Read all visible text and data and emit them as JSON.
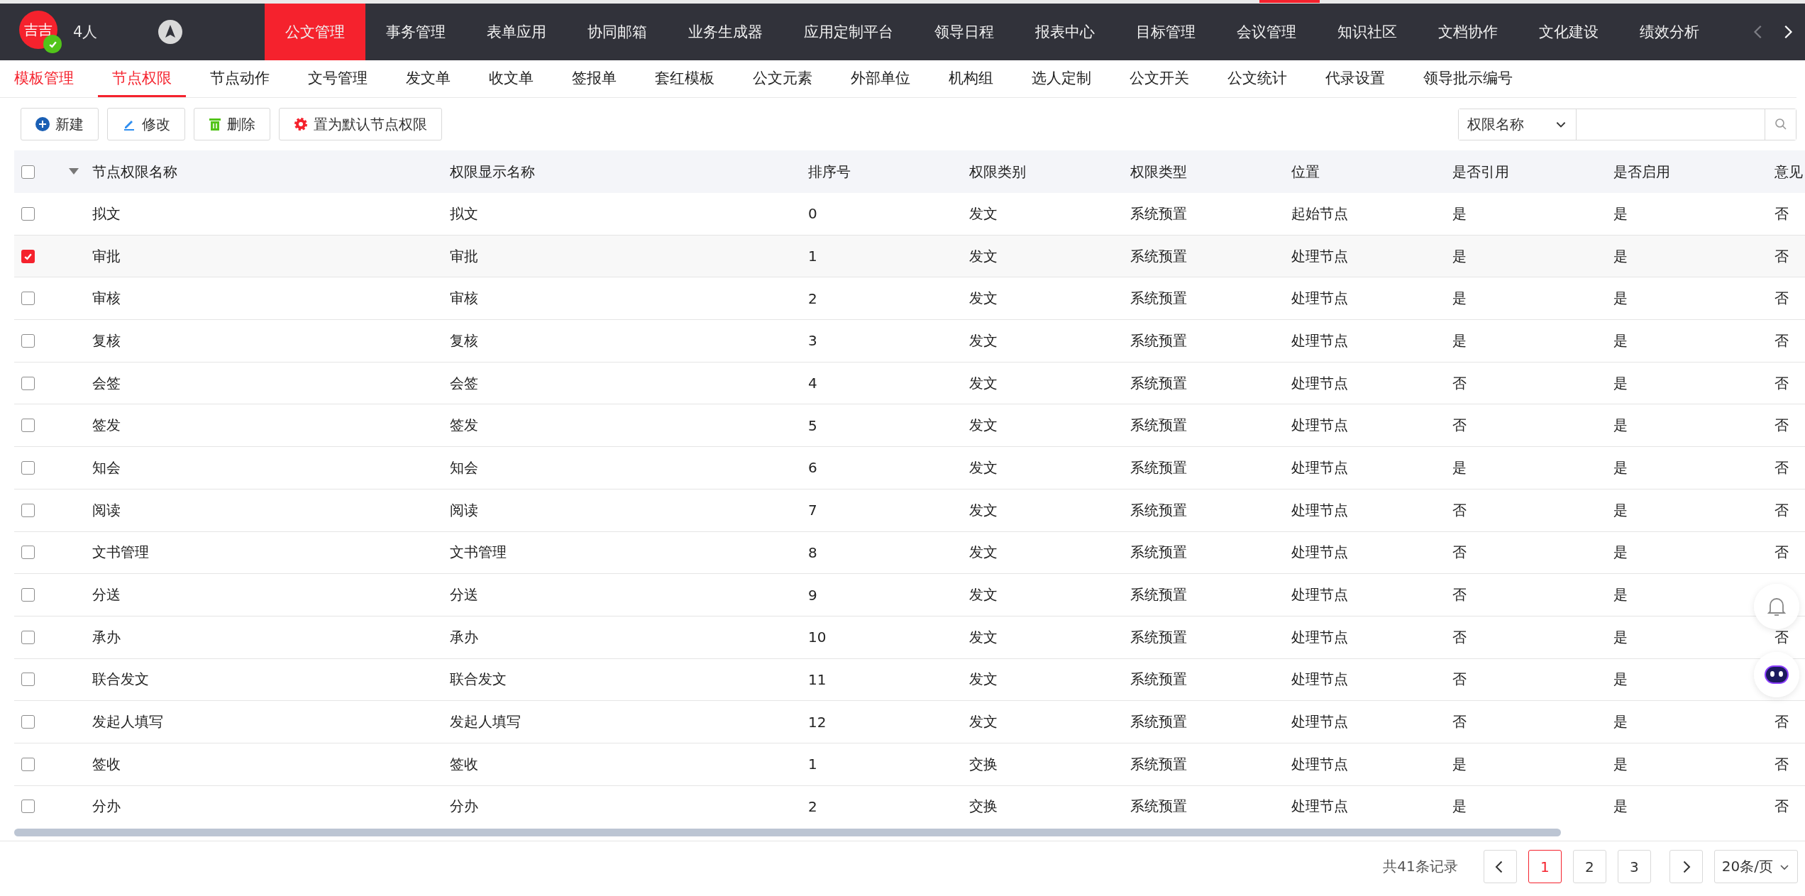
{
  "topbar": {
    "avatar": "吉吉",
    "online_badge": true,
    "people": "4人",
    "nav": [
      {
        "label": "公文管理",
        "selected": true
      },
      {
        "label": "事务管理",
        "selected": false
      },
      {
        "label": "表单应用",
        "selected": false
      },
      {
        "label": "协同邮箱",
        "selected": false
      },
      {
        "label": "业务生成器",
        "selected": false
      },
      {
        "label": "应用定制平台",
        "selected": false
      },
      {
        "label": "领导日程",
        "selected": false
      },
      {
        "label": "报表中心",
        "selected": false
      },
      {
        "label": "目标管理",
        "selected": false
      },
      {
        "label": "会议管理",
        "selected": false
      },
      {
        "label": "知识社区",
        "selected": false
      },
      {
        "label": "文档协作",
        "selected": false
      },
      {
        "label": "文化建设",
        "selected": false
      },
      {
        "label": "绩效分析",
        "selected": false
      }
    ],
    "nav_prev_disabled": true
  },
  "subtabs": [
    {
      "label": "模板管理",
      "selected": false,
      "highlight": true
    },
    {
      "label": "节点权限",
      "selected": true,
      "highlight": false
    },
    {
      "label": "节点动作",
      "selected": false,
      "highlight": false
    },
    {
      "label": "文号管理",
      "selected": false,
      "highlight": false
    },
    {
      "label": "发文单",
      "selected": false,
      "highlight": false
    },
    {
      "label": "收文单",
      "selected": false,
      "highlight": false
    },
    {
      "label": "签报单",
      "selected": false,
      "highlight": false
    },
    {
      "label": "套红模板",
      "selected": false,
      "highlight": false
    },
    {
      "label": "公文元素",
      "selected": false,
      "highlight": false
    },
    {
      "label": "外部单位",
      "selected": false,
      "highlight": false
    },
    {
      "label": "机构组",
      "selected": false,
      "highlight": false
    },
    {
      "label": "选人定制",
      "selected": false,
      "highlight": false
    },
    {
      "label": "公文开关",
      "selected": false,
      "highlight": false
    },
    {
      "label": "公文统计",
      "selected": false,
      "highlight": false
    },
    {
      "label": "代录设置",
      "selected": false,
      "highlight": false
    },
    {
      "label": "领导批示编号",
      "selected": false,
      "highlight": false
    }
  ],
  "toolbar": [
    {
      "kind": "new",
      "label": "新建"
    },
    {
      "kind": "edit",
      "label": "修改"
    },
    {
      "kind": "delete",
      "label": "删除"
    },
    {
      "kind": "default",
      "label": "置为默认节点权限"
    }
  ],
  "search": {
    "field": "权限名称"
  },
  "table": {
    "all_checked": false,
    "columns": [
      "节点权限名称",
      "权限显示名称",
      "排序号",
      "权限类别",
      "权限类型",
      "位置",
      "是否引用",
      "是否启用",
      "意见"
    ],
    "rows": [
      {
        "checked": false,
        "cells": [
          "拟文",
          "拟文",
          "0",
          "发文",
          "系统预置",
          "起始节点",
          "是",
          "是",
          "否"
        ]
      },
      {
        "checked": true,
        "cells": [
          "审批",
          "审批",
          "1",
          "发文",
          "系统预置",
          "处理节点",
          "是",
          "是",
          "否"
        ]
      },
      {
        "checked": false,
        "cells": [
          "审核",
          "审核",
          "2",
          "发文",
          "系统预置",
          "处理节点",
          "是",
          "是",
          "否"
        ]
      },
      {
        "checked": false,
        "cells": [
          "复核",
          "复核",
          "3",
          "发文",
          "系统预置",
          "处理节点",
          "是",
          "是",
          "否"
        ]
      },
      {
        "checked": false,
        "cells": [
          "会签",
          "会签",
          "4",
          "发文",
          "系统预置",
          "处理节点",
          "否",
          "是",
          "否"
        ]
      },
      {
        "checked": false,
        "cells": [
          "签发",
          "签发",
          "5",
          "发文",
          "系统预置",
          "处理节点",
          "否",
          "是",
          "否"
        ]
      },
      {
        "checked": false,
        "cells": [
          "知会",
          "知会",
          "6",
          "发文",
          "系统预置",
          "处理节点",
          "是",
          "是",
          "否"
        ]
      },
      {
        "checked": false,
        "cells": [
          "阅读",
          "阅读",
          "7",
          "发文",
          "系统预置",
          "处理节点",
          "否",
          "是",
          "否"
        ]
      },
      {
        "checked": false,
        "cells": [
          "文书管理",
          "文书管理",
          "8",
          "发文",
          "系统预置",
          "处理节点",
          "否",
          "是",
          "否"
        ]
      },
      {
        "checked": false,
        "cells": [
          "分送",
          "分送",
          "9",
          "发文",
          "系统预置",
          "处理节点",
          "否",
          "是"
        ]
      },
      {
        "checked": false,
        "cells": [
          "承办",
          "承办",
          "10",
          "发文",
          "系统预置",
          "处理节点",
          "否",
          "是",
          "否"
        ]
      },
      {
        "checked": false,
        "cells": [
          "联合发文",
          "联合发文",
          "11",
          "发文",
          "系统预置",
          "处理节点",
          "否",
          "是"
        ]
      },
      {
        "checked": false,
        "cells": [
          "发起人填写",
          "发起人填写",
          "12",
          "发文",
          "系统预置",
          "处理节点",
          "否",
          "是",
          "否"
        ]
      },
      {
        "checked": false,
        "cells": [
          "签收",
          "签收",
          "1",
          "交换",
          "系统预置",
          "处理节点",
          "是",
          "是",
          "否"
        ]
      },
      {
        "checked": false,
        "cells": [
          "分办",
          "分办",
          "2",
          "交换",
          "系统预置",
          "处理节点",
          "是",
          "是",
          "否"
        ]
      }
    ]
  },
  "pagination": {
    "total": "共41条记录",
    "pages": [
      {
        "label": "1",
        "selected": true
      },
      {
        "label": "2",
        "selected": false
      },
      {
        "label": "3",
        "selected": false
      }
    ],
    "page_size": "20条/页"
  }
}
